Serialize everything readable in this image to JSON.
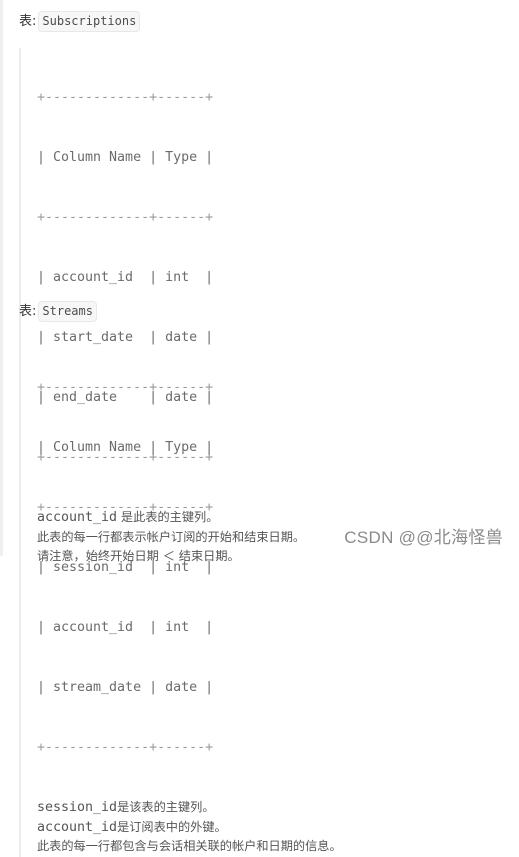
{
  "tables": [
    {
      "label_prefix": "表:",
      "name": "Subscriptions",
      "border_line": "+-------------+------+",
      "header_line": "| Column Name | Type |",
      "rows": [
        "| account_id  | int  |",
        "| start_date  | date |",
        "| end_date    | date |"
      ],
      "notes": [
        {
          "code": "account_id",
          "text": " 是此表的主键列。"
        },
        {
          "code": "",
          "text": "此表的每一行都表示帐户订阅的开始和结束日期。"
        },
        {
          "code": "",
          "text": "请注意，始终开始日期 ＜ 结束日期。"
        }
      ]
    },
    {
      "label_prefix": "表:",
      "name": "Streams",
      "border_line": "+-------------+------+",
      "header_line": "| Column Name | Type |",
      "rows": [
        "| session_id  | int  |",
        "| account_id  | int  |",
        "| stream_date | date |"
      ],
      "notes": [
        {
          "code": "session_id",
          "text": "是该表的主键列。"
        },
        {
          "code": "account_id",
          "text": "是订阅表中的外键。"
        },
        {
          "code": "",
          "text": "此表的每一行都包含与会话相关联的帐户和日期的信息。"
        }
      ]
    }
  ],
  "watermark": "CSDN @@北海怪兽"
}
